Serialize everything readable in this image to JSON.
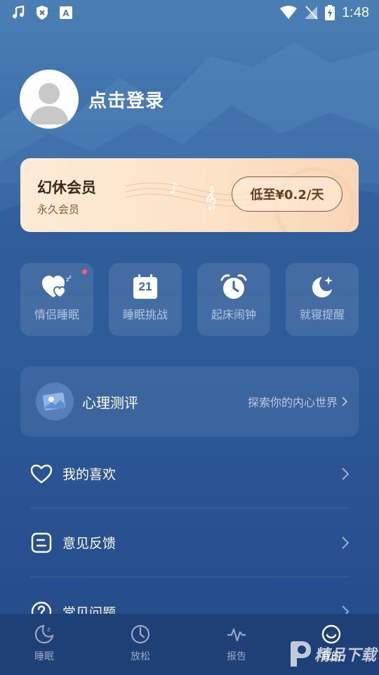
{
  "status_bar": {
    "time": "1:48"
  },
  "profile": {
    "login_label": "点击登录"
  },
  "vip": {
    "title": "幻休会员",
    "subtitle": "永久会员",
    "button": "低至¥0.2/天"
  },
  "shortcuts": [
    {
      "label": "情侣睡眠",
      "icon": "couple-sleep-heart-icon",
      "badge": true
    },
    {
      "label": "睡眠挑战",
      "icon": "calendar-21-icon",
      "calendar_day": "21"
    },
    {
      "label": "起床闹钟",
      "icon": "alarm-clock-icon"
    },
    {
      "label": "就寝提醒",
      "icon": "moon-star-icon"
    }
  ],
  "psych": {
    "title": "心理测评",
    "subtitle": "探索你的内心世界"
  },
  "menu": [
    {
      "label": "我的喜欢",
      "icon": "heart-outline-icon"
    },
    {
      "label": "意见反馈",
      "icon": "feedback-icon"
    },
    {
      "label": "常见问题",
      "icon": "question-circle-icon"
    }
  ],
  "bottom_nav": [
    {
      "label": "睡眠",
      "icon": "sleep-moon-icon"
    },
    {
      "label": "放松",
      "icon": "relax-dial-icon"
    },
    {
      "label": "报告",
      "icon": "report-pulse-icon"
    },
    {
      "label": "我的",
      "icon": "smile-face-icon",
      "active": true
    }
  ],
  "watermark": {
    "text": "精品下载"
  },
  "colors": {
    "accent_gold": "#8c5a35",
    "card_bg": "#fbe1c6",
    "nav_bg": "#1f3f77",
    "badge_red": "#ff5c5c"
  }
}
